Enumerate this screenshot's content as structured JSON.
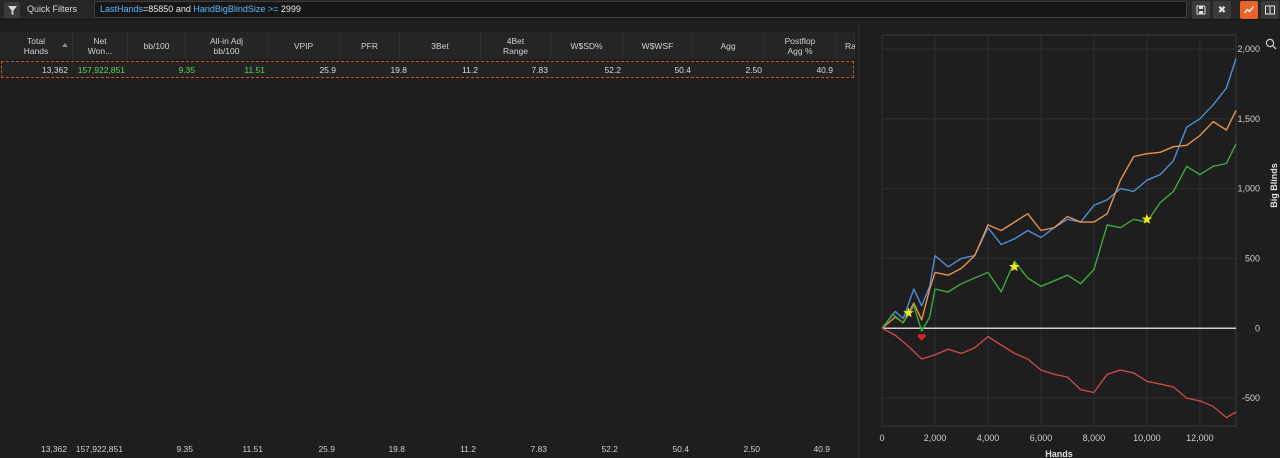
{
  "toolbar": {
    "quick_filters_label": "Quick Filters",
    "filter_parts": [
      {
        "text": "LastHands",
        "kind": "kw"
      },
      {
        "text": "=85850 and ",
        "kind": "plain"
      },
      {
        "text": "HandBigBlindSize",
        "kind": "kw"
      },
      {
        "text": " >= ",
        "kind": "kw"
      },
      {
        "text": "2999",
        "kind": "plain"
      }
    ],
    "icons": [
      "filter-icon",
      "save-icon",
      "clear-icon",
      "graph-icon",
      "layout-icon"
    ],
    "close_glyph": "✖"
  },
  "table": {
    "columns": [
      "Total\nHands",
      "Net\nWon...",
      "bb/100",
      "All-in Adj\nbb/100",
      "VPIP",
      "PFR",
      "3Bet",
      "4Bet\nRange",
      "W$SD%",
      "W$WSF",
      "Agg",
      "Postflop\nAgg %",
      "Ra"
    ],
    "row": [
      "13,362",
      "157,922,851",
      "9.35",
      "11.51",
      "25.9",
      "19.8",
      "11.2",
      "7.83",
      "52.2",
      "50.4",
      "2.50",
      "40.9"
    ],
    "row_green": [
      false,
      true,
      true,
      true,
      false,
      false,
      false,
      false,
      false,
      false,
      false,
      false
    ],
    "footer": [
      "13,362",
      "157,922,851",
      "9.35",
      "11.51",
      "25.9",
      "19.8",
      "11.2",
      "7.83",
      "52.2",
      "50.4",
      "2.50",
      "40.9"
    ]
  },
  "chart_data": {
    "type": "line",
    "xlabel": "Hands",
    "ylabel": "Big Blinds",
    "xlim": [
      0,
      13362
    ],
    "ylim": [
      -700,
      2100
    ],
    "x_ticks": [
      "0",
      "2,000",
      "4,000",
      "6,000",
      "8,000",
      "10,000",
      "12,000"
    ],
    "x_tick_values": [
      0,
      2000,
      4000,
      6000,
      8000,
      10000,
      12000
    ],
    "y_ticks": [
      "-500",
      "0",
      "500",
      "1,000",
      "1,500",
      "2,000"
    ],
    "y_tick_values": [
      -500,
      0,
      500,
      1000,
      1500,
      2000
    ],
    "grid": true,
    "series": [
      {
        "color": "#4f8fd6",
        "x": [
          0,
          500,
          800,
          1200,
          1500,
          1800,
          2000,
          2500,
          3000,
          3500,
          4000,
          4500,
          5000,
          5500,
          6000,
          6500,
          7000,
          7500,
          8000,
          8500,
          9000,
          9500,
          10000,
          10500,
          11000,
          11500,
          12000,
          12500,
          13000,
          13362
        ],
        "y": [
          0,
          120,
          70,
          280,
          160,
          300,
          520,
          440,
          500,
          520,
          720,
          600,
          640,
          700,
          650,
          720,
          780,
          760,
          880,
          920,
          1000,
          980,
          1060,
          1100,
          1200,
          1440,
          1500,
          1600,
          1720,
          1930
        ]
      },
      {
        "color": "#e8924a",
        "x": [
          0,
          500,
          800,
          1200,
          1500,
          1800,
          2000,
          2500,
          3000,
          3500,
          4000,
          4500,
          5000,
          5500,
          6000,
          6500,
          7000,
          7500,
          8000,
          8500,
          9000,
          9500,
          10000,
          10500,
          11000,
          11500,
          12000,
          12500,
          13000,
          13362
        ],
        "y": [
          0,
          80,
          40,
          180,
          60,
          280,
          400,
          380,
          430,
          520,
          740,
          700,
          760,
          820,
          700,
          720,
          800,
          760,
          760,
          820,
          1060,
          1230,
          1250,
          1260,
          1300,
          1310,
          1380,
          1480,
          1420,
          1560
        ]
      },
      {
        "color": "#3fa83f",
        "x": [
          0,
          400,
          800,
          1200,
          1500,
          1800,
          2000,
          2500,
          3000,
          3500,
          4000,
          4500,
          5000,
          5500,
          6000,
          6500,
          7000,
          7500,
          8000,
          8500,
          9000,
          9500,
          10000,
          10500,
          11000,
          11500,
          12000,
          12500,
          13000,
          13362
        ],
        "y": [
          0,
          100,
          40,
          160,
          -20,
          80,
          280,
          260,
          320,
          360,
          400,
          260,
          480,
          360,
          300,
          340,
          380,
          320,
          420,
          740,
          720,
          780,
          760,
          900,
          980,
          1160,
          1100,
          1160,
          1180,
          1320
        ]
      },
      {
        "color": "#c24a4a",
        "x": [
          0,
          500,
          1000,
          1500,
          2000,
          2500,
          3000,
          3500,
          4000,
          4500,
          5000,
          5500,
          6000,
          6500,
          7000,
          7500,
          8000,
          8500,
          9000,
          9500,
          10000,
          10500,
          11000,
          11500,
          12000,
          12500,
          13000,
          13362
        ],
        "y": [
          0,
          -50,
          -130,
          -220,
          -190,
          -150,
          -180,
          -140,
          -60,
          -120,
          -180,
          -220,
          -300,
          -330,
          -350,
          -440,
          -460,
          -330,
          -300,
          -320,
          -380,
          -400,
          -420,
          -500,
          -520,
          -560,
          -640,
          -600
        ]
      }
    ],
    "markers": [
      {
        "kind": "star",
        "x": 1000,
        "y": 110,
        "color": "#f5e81a"
      },
      {
        "kind": "star",
        "x": 5000,
        "y": 440,
        "color": "#f5e81a"
      },
      {
        "kind": "star",
        "x": 10000,
        "y": 780,
        "color": "#f5e81a"
      },
      {
        "kind": "heart",
        "x": 1500,
        "y": -60,
        "color": "#e02020"
      }
    ],
    "zero_line_color": "#d0d0d0"
  }
}
